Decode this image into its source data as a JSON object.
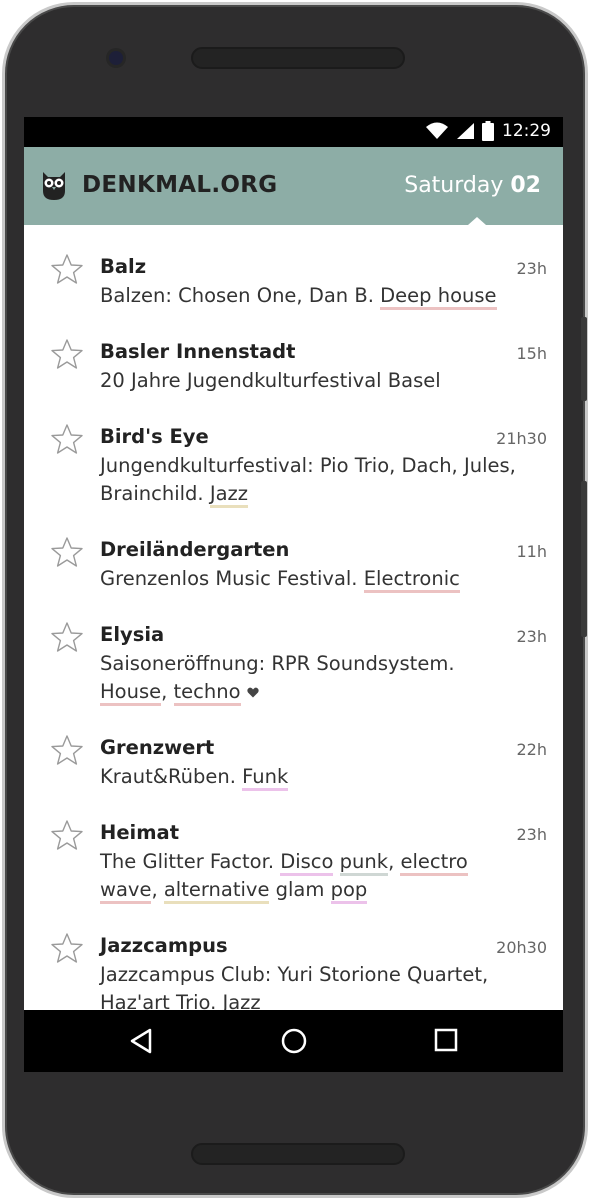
{
  "status": {
    "time": "12:29",
    "icons": [
      "wifi-icon",
      "signal-icon",
      "battery-icon"
    ]
  },
  "header": {
    "logo_icon": "owl-icon",
    "brand": "DENKMAL.ORG",
    "day": "Saturday",
    "date": "02",
    "color": "#8dada6"
  },
  "events": [
    {
      "venue": "Balz",
      "time": "23h",
      "desc": [
        "Balzen: Chosen One, Dan B. ",
        {
          "tag": "Deep house",
          "color": "red"
        }
      ]
    },
    {
      "venue": "Basler Innenstadt",
      "time": "15h",
      "desc": [
        "20 Jahre Jugendkulturfestival Basel"
      ]
    },
    {
      "venue": "Bird's Eye",
      "time": "21h30",
      "desc": [
        "Jungendkulturfestival: Pio Trio, Dach, Jules, Brainchild. ",
        {
          "tag": "Jazz",
          "color": "yellow"
        }
      ]
    },
    {
      "venue": "Dreiländergarten",
      "time": "11h",
      "desc": [
        "Grenzenlos Music Festival. ",
        {
          "tag": "Electronic",
          "color": "red"
        }
      ]
    },
    {
      "venue": "Elysia",
      "time": "23h",
      "desc": [
        "Saisoneröffnung: RPR Soundsystem. ",
        {
          "tag": "House",
          "color": "red"
        },
        ", ",
        {
          "tag": "techno",
          "color": "red"
        },
        {
          "icon": "heart-icon"
        }
      ]
    },
    {
      "venue": "Grenzwert",
      "time": "22h",
      "desc": [
        "Kraut&Rüben. ",
        {
          "tag": "Funk",
          "color": "pink"
        }
      ]
    },
    {
      "venue": "Heimat",
      "time": "23h",
      "desc": [
        "The Glitter Factor. ",
        {
          "tag": "Disco",
          "color": "pink"
        },
        " ",
        {
          "tag": "punk",
          "color": "gray"
        },
        ", ",
        {
          "tag": "electro wave",
          "color": "red"
        },
        ", ",
        {
          "tag": "alternative",
          "color": "yellow"
        },
        " glam ",
        {
          "tag": "pop",
          "color": "pink"
        }
      ]
    },
    {
      "venue": "Jazzcampus",
      "time": "20h30",
      "desc": [
        "Jazzcampus Club: Yuri Storione Quartet, Haz'art Trio. ",
        {
          "tag": "Jazz",
          "color": "yellow"
        }
      ]
    }
  ],
  "navigation": {
    "buttons": [
      "back-icon",
      "home-icon",
      "recents-icon"
    ]
  }
}
